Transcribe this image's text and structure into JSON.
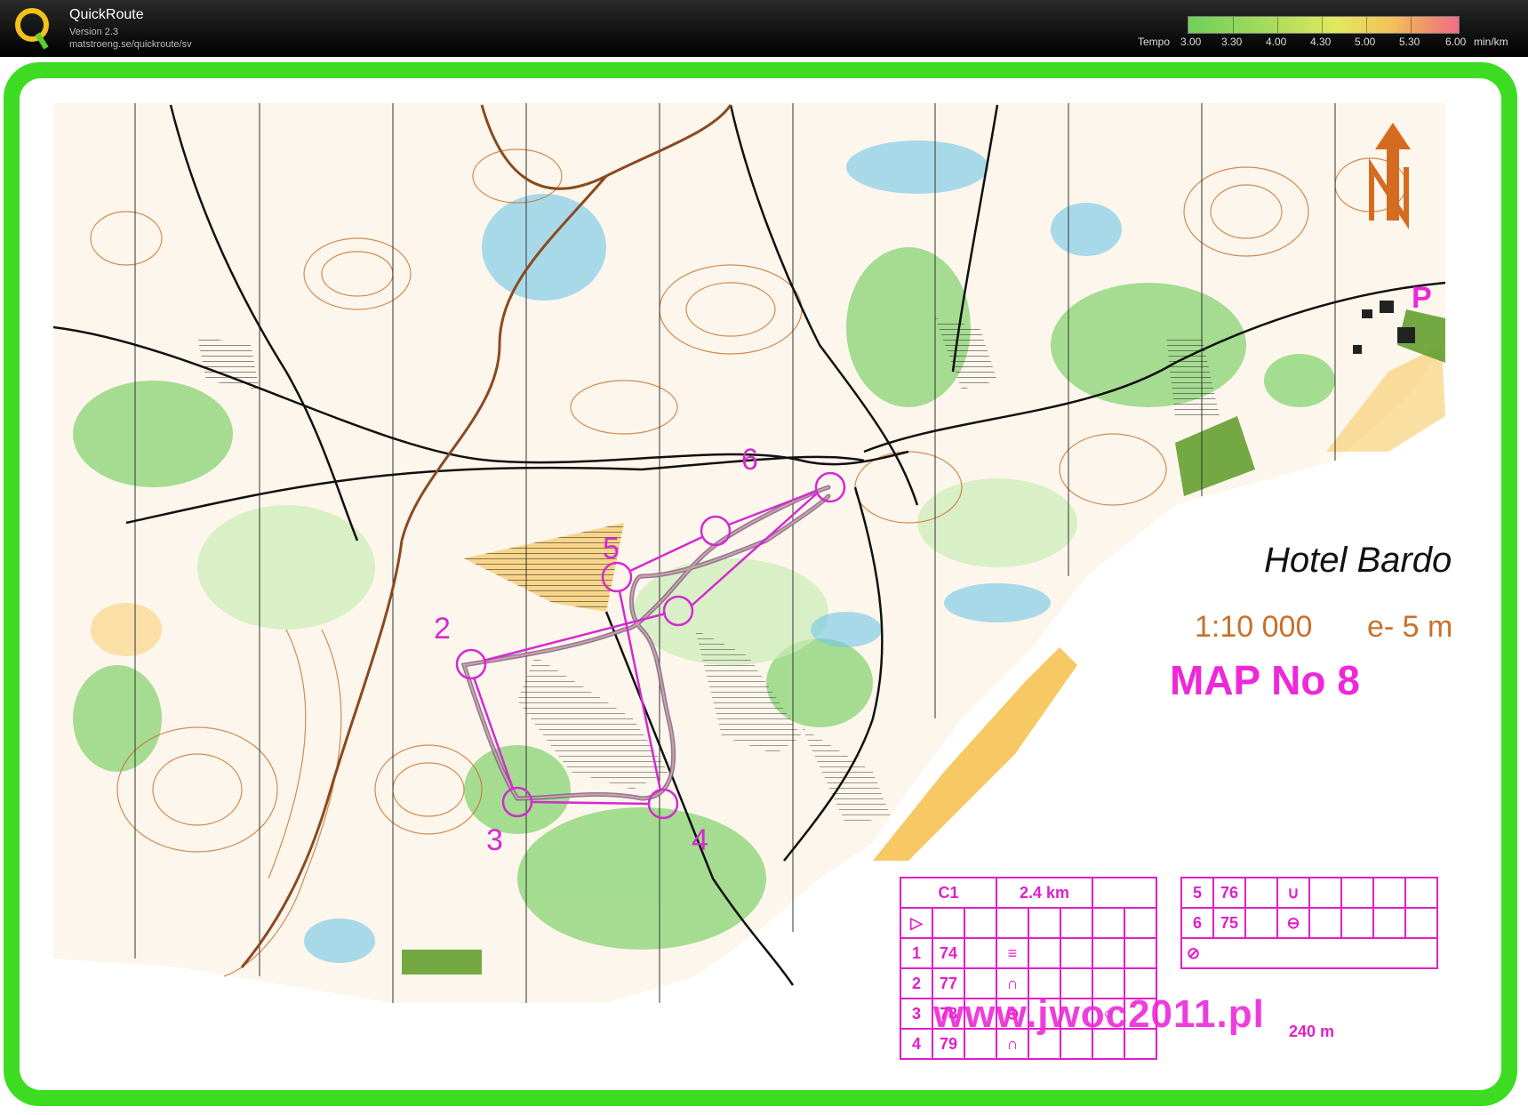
{
  "app": {
    "title": "QuickRoute",
    "version": "Version 2.3",
    "url": "matstroeng.se/quickroute/sv"
  },
  "tempo": {
    "prefix": "Tempo",
    "labels": [
      "3.00",
      "3.30",
      "4.00",
      "4.30",
      "5.00",
      "5.30",
      "6.00"
    ],
    "unit": "min/km"
  },
  "map": {
    "hotel": "Hotel Bardo",
    "scale": "1:10 000",
    "contour": "e- 5 m",
    "map_no": "MAP No 8",
    "parking": "P",
    "north": "N",
    "watermark": "www.jwoc2011.pl",
    "controls": [
      "2",
      "3",
      "4",
      "5",
      "6"
    ]
  },
  "description": {
    "course": "C1",
    "length": "2.4 km",
    "rows_left": [
      {
        "n": "1",
        "code": "74"
      },
      {
        "n": "2",
        "code": "77"
      },
      {
        "n": "3",
        "code": "78"
      },
      {
        "n": "4",
        "code": "79"
      }
    ],
    "rows_right": [
      {
        "n": "5",
        "code": "76"
      },
      {
        "n": "6",
        "code": "75"
      }
    ],
    "finish_leg": "240 m"
  },
  "colors": {
    "frame": "#3ddc23",
    "overprint": "#ee28d8",
    "contour": "#c8702a",
    "vegetation": "#8ed67a"
  }
}
